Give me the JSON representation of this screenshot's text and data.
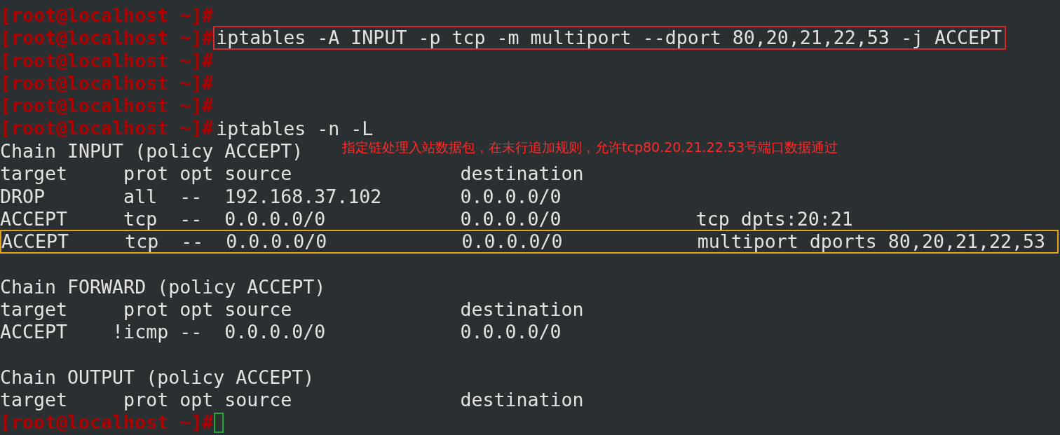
{
  "terminal": {
    "lines": [
      {
        "kind": "prompt",
        "prompt": "[root@localhost ~]#"
      },
      {
        "kind": "prompt",
        "prompt": "[root@localhost ~]#",
        "command": "iptables -A INPUT -p tcp -m multiport --dport 80,20,21,22,53 -j ACCEPT",
        "boxed": true
      },
      {
        "kind": "prompt",
        "prompt": "[root@localhost ~]#"
      },
      {
        "kind": "prompt",
        "prompt": "[root@localhost ~]#"
      },
      {
        "kind": "prompt",
        "prompt": "[root@localhost ~]#"
      },
      {
        "kind": "prompt",
        "prompt": "[root@localhost ~]#",
        "command": "iptables -n -L",
        "boxed": false
      },
      {
        "kind": "output",
        "text": "Chain INPUT (policy ACCEPT)",
        "boxed": false,
        "annotation": "指定链处理入站数据包，在末行追加规则，允许tcp80.20.21.22.53号端口数据通过"
      },
      {
        "kind": "output",
        "text": "target     prot opt source               destination",
        "boxed": false
      },
      {
        "kind": "output",
        "text": "DROP       all  --  192.168.37.102       0.0.0.0/0",
        "boxed": false
      },
      {
        "kind": "output",
        "text": "ACCEPT     tcp  --  0.0.0.0/0            0.0.0.0/0            tcp dpts:20:21",
        "boxed": false
      },
      {
        "kind": "output",
        "text": "ACCEPT     tcp  --  0.0.0.0/0            0.0.0.0/0            multiport dports 80,20,21,22,53",
        "boxed": true
      },
      {
        "kind": "blank"
      },
      {
        "kind": "output",
        "text": "Chain FORWARD (policy ACCEPT)",
        "boxed": false
      },
      {
        "kind": "output",
        "text": "target     prot opt source               destination",
        "boxed": false
      },
      {
        "kind": "output",
        "text": "ACCEPT    !icmp --  0.0.0.0/0            0.0.0.0/0",
        "boxed": false
      },
      {
        "kind": "blank"
      },
      {
        "kind": "output",
        "text": "Chain OUTPUT (policy ACCEPT)",
        "boxed": false
      },
      {
        "kind": "output",
        "text": "target     prot opt source               destination",
        "boxed": false
      },
      {
        "kind": "prompt",
        "prompt": "[root@localhost ~]#",
        "cursor": true
      }
    ]
  }
}
